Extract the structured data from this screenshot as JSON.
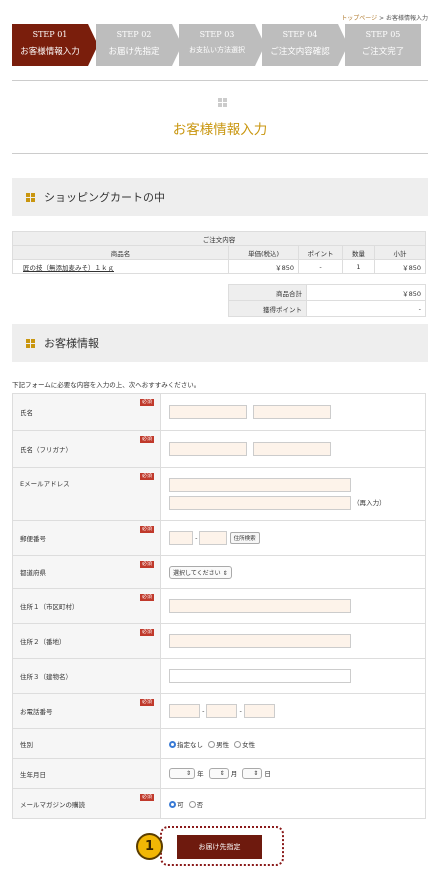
{
  "breadcrumb": {
    "home": "トップページ",
    "sep": " > ",
    "current": "お客様情報入力"
  },
  "steps": [
    {
      "num": "STEP 01",
      "label": "お客様情報入力"
    },
    {
      "num": "STEP 02",
      "label": "お届け先指定"
    },
    {
      "num": "STEP 03",
      "label": "お支払い方法選択"
    },
    {
      "num": "STEP 04",
      "label": "ご注文内容確認"
    },
    {
      "num": "STEP 05",
      "label": "ご注文完了"
    }
  ],
  "page_title": "お客様情報入力",
  "cart": {
    "heading": "ショッピングカートの中",
    "caption": "ご注文内容",
    "columns": [
      "商品名",
      "単価(税込)",
      "ポイント",
      "数量",
      "小計"
    ],
    "rows": [
      {
        "name": "匠の技（無添加麦みそ）１ｋｇ",
        "price": "￥850",
        "points": "-",
        "qty": "1",
        "subtotal": "￥850"
      }
    ],
    "total_label": "商品合計",
    "total_value": "￥850",
    "points_label": "獲得ポイント",
    "points_value": "-"
  },
  "customer": {
    "heading": "お客様情報",
    "intro": "下記フォームに必要な内容を入力の上、次へおすすみください。",
    "required": "必須",
    "fields": {
      "name": "氏名",
      "kana": "氏名（フリガナ）",
      "email": "Eメールアドレス",
      "email_reenter": "（再入力）",
      "zip": "郵便番号",
      "zip_search": "住所検索",
      "pref": "都道府県",
      "pref_select": "選択してください",
      "addr1": "住所１（市区町村）",
      "addr2": "住所２（番地）",
      "addr3": "住所３（建物名）",
      "phone": "お電話番号",
      "gender": "性別",
      "gender_opts": [
        "指定なし",
        "男性",
        "女性"
      ],
      "birthday": "生年月日",
      "year": "年",
      "month": "月",
      "day": "日",
      "newsletter": "メールマガジンの購読",
      "newsletter_opts": [
        "可",
        "否"
      ]
    }
  },
  "submit_label": "お届け先指定",
  "badge_num": "1"
}
